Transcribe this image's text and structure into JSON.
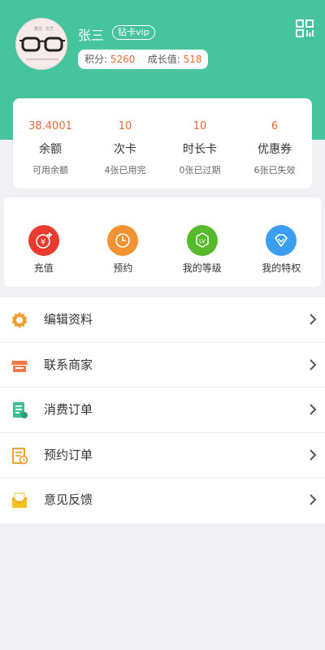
{
  "profile": {
    "name": "张三",
    "vip_badge": "钻卡vip",
    "points_label": "积分:",
    "points_value": "5260",
    "growth_label": "成长值:",
    "growth_value": "518",
    "avatar_text": "复古 文艺"
  },
  "balances": [
    {
      "value": "38.4001",
      "title": "余额",
      "sub": "可用余额"
    },
    {
      "value": "10",
      "title": "次卡",
      "sub": "4张已用完"
    },
    {
      "value": "10",
      "title": "时长卡",
      "sub": "0张已过期"
    },
    {
      "value": "6",
      "title": "优惠券",
      "sub": "6张已失效"
    }
  ],
  "actions": [
    {
      "label": "充值",
      "icon": "yen-plus-icon",
      "color": "#ea3b2f"
    },
    {
      "label": "预约",
      "icon": "clock-icon",
      "color": "#f49232"
    },
    {
      "label": "我的等级",
      "icon": "level-badge-icon",
      "color": "#56ba2a"
    },
    {
      "label": "我的特权",
      "icon": "diamond-icon",
      "color": "#3a9ef2"
    }
  ],
  "menu": [
    {
      "label": "编辑资料",
      "icon": "gear-icon"
    },
    {
      "label": "联系商家",
      "icon": "store-icon"
    },
    {
      "label": "消费订单",
      "icon": "receipt-icon"
    },
    {
      "label": "预约订单",
      "icon": "calendar-order-icon"
    },
    {
      "label": "意见反馈",
      "icon": "feedback-envelope-icon"
    }
  ],
  "colors": {
    "header": "#45c49e",
    "accent_value": "#e86a3a"
  }
}
